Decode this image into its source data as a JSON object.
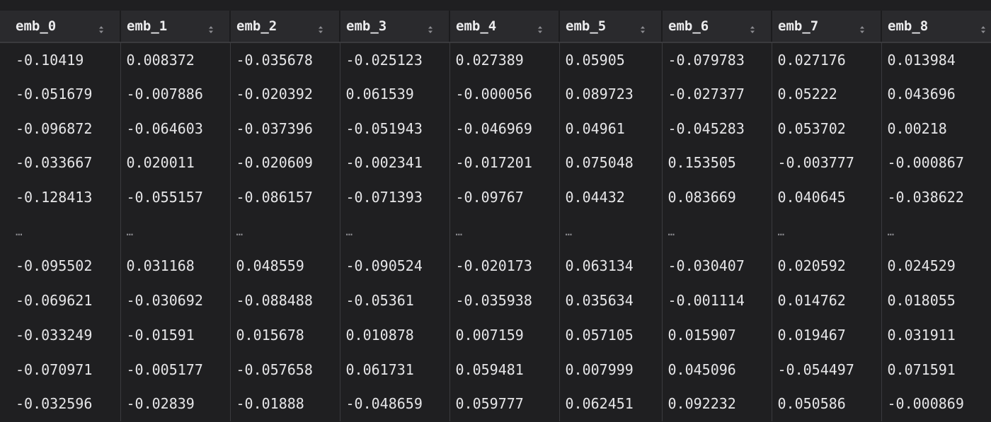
{
  "table": {
    "columns": [
      "emb_0",
      "emb_1",
      "emb_2",
      "emb_3",
      "emb_4",
      "emb_5",
      "emb_6",
      "emb_7",
      "emb_8"
    ],
    "rows": [
      [
        "-0.10419",
        "0.008372",
        "-0.035678",
        "-0.025123",
        "0.027389",
        "0.05905",
        "-0.079783",
        "0.027176",
        "0.013984"
      ],
      [
        "-0.051679",
        "-0.007886",
        "-0.020392",
        "0.061539",
        "-0.000056",
        "0.089723",
        "-0.027377",
        "0.05222",
        "0.043696"
      ],
      [
        "-0.096872",
        "-0.064603",
        "-0.037396",
        "-0.051943",
        "-0.046969",
        "0.04961",
        "-0.045283",
        "0.053702",
        "0.00218"
      ],
      [
        "-0.033667",
        "0.020011",
        "-0.020609",
        "-0.002341",
        "-0.017201",
        "0.075048",
        "0.153505",
        "-0.003777",
        "-0.000867"
      ],
      [
        "-0.128413",
        "-0.055157",
        "-0.086157",
        "-0.071393",
        "-0.09767",
        "0.04432",
        "0.083669",
        "0.040645",
        "-0.038622"
      ],
      [
        "…",
        "…",
        "…",
        "…",
        "…",
        "…",
        "…",
        "…",
        "…"
      ],
      [
        "-0.095502",
        "0.031168",
        "0.048559",
        "-0.090524",
        "-0.020173",
        "0.063134",
        "-0.030407",
        "0.020592",
        "0.024529"
      ],
      [
        "-0.069621",
        "-0.030692",
        "-0.088488",
        "-0.05361",
        "-0.035938",
        "0.035634",
        "-0.001114",
        "0.014762",
        "0.018055"
      ],
      [
        "-0.033249",
        "-0.01591",
        "0.015678",
        "0.010878",
        "0.007159",
        "0.057105",
        "0.015907",
        "0.019467",
        "0.031911"
      ],
      [
        "-0.070971",
        "-0.005177",
        "-0.057658",
        "0.061731",
        "0.059481",
        "0.007999",
        "0.045096",
        "-0.054497",
        "0.071591"
      ],
      [
        "-0.032596",
        "-0.02839",
        "-0.01888",
        "-0.048659",
        "0.059777",
        "0.062451",
        "0.092232",
        "0.050586",
        "-0.000869"
      ]
    ],
    "ellipsis_row_index": 5,
    "sort_icon": "sort-updown-icon",
    "colors": {
      "background": "#1f1f21",
      "header_bg": "#2a2a2d",
      "header_text": "#ececee",
      "cell_text": "#e6e6e8",
      "ellipsis_text": "#8e8e93",
      "sort_icon": "#8e8e93",
      "divider": "#3a3a3e"
    }
  }
}
